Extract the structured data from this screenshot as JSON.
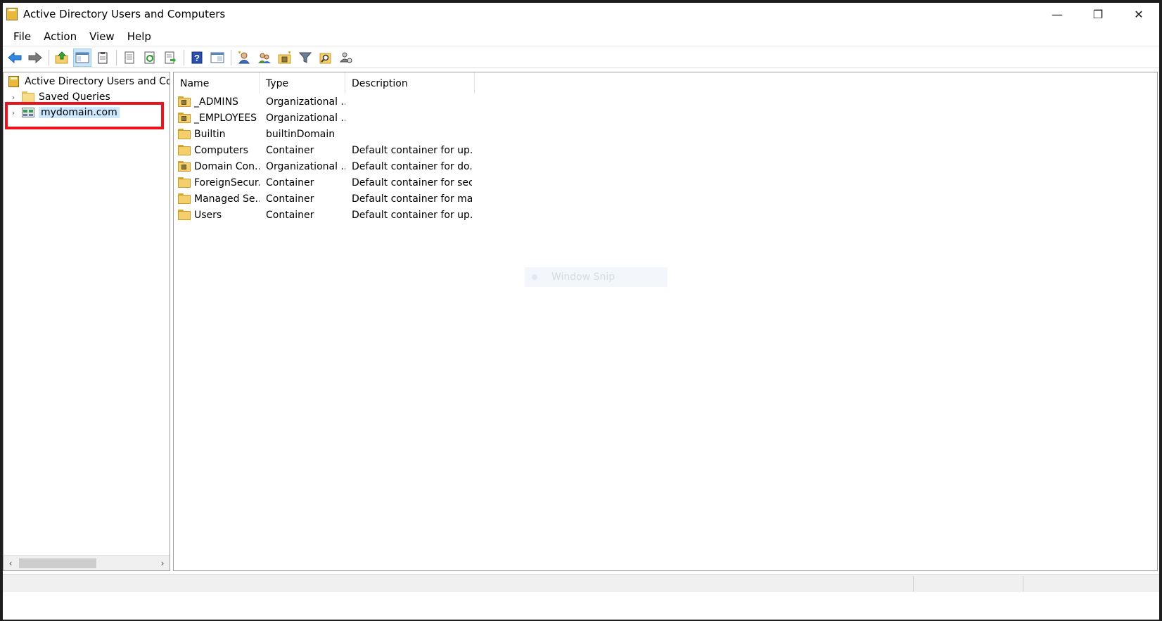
{
  "window": {
    "title": "Active Directory Users and Computers",
    "controls": {
      "minimize": "—",
      "restore": "❐",
      "close": "✕"
    }
  },
  "menu": [
    "File",
    "Action",
    "View",
    "Help"
  ],
  "toolbar": {
    "buttons": [
      "back-icon",
      "forward-icon",
      "up-folder-icon",
      "show-console-tree-icon",
      "clipboard-icon",
      "properties-icon",
      "refresh-icon",
      "export-list-icon",
      "help-icon",
      "view-icon",
      "new-user-icon",
      "new-group-icon",
      "new-ou-icon",
      "filter-icon",
      "find-icon",
      "delegate-icon"
    ]
  },
  "tree": {
    "root": "Active Directory Users and Computers",
    "items": [
      {
        "label": "Saved Queries",
        "expander": "›"
      },
      {
        "label": "mydomain.com",
        "expander": "›"
      }
    ]
  },
  "list": {
    "columns": [
      "Name",
      "Type",
      "Description"
    ],
    "rows": [
      {
        "name": "_ADMINS",
        "type": "Organizational ...",
        "description": "",
        "icon": "ou-folder-icon"
      },
      {
        "name": "_EMPLOYEES",
        "type": "Organizational ...",
        "description": "",
        "icon": "ou-folder-icon"
      },
      {
        "name": "Builtin",
        "type": "builtinDomain",
        "description": "",
        "icon": "folder-icon"
      },
      {
        "name": "Computers",
        "type": "Container",
        "description": "Default container for up...",
        "icon": "folder-icon"
      },
      {
        "name": "Domain Con...",
        "type": "Organizational ...",
        "description": "Default container for do...",
        "icon": "ou-folder-icon"
      },
      {
        "name": "ForeignSecur...",
        "type": "Container",
        "description": "Default container for sec...",
        "icon": "folder-icon"
      },
      {
        "name": "Managed Se...",
        "type": "Container",
        "description": "Default container for ma...",
        "icon": "folder-icon"
      },
      {
        "name": "Users",
        "type": "Container",
        "description": "Default container for up...",
        "icon": "folder-icon"
      }
    ]
  },
  "overlay": {
    "ghost_label": "Window Snip"
  },
  "colors": {
    "highlight": "#e8131c",
    "selection": "#cce8ff",
    "folder": "#f5cf6b"
  }
}
